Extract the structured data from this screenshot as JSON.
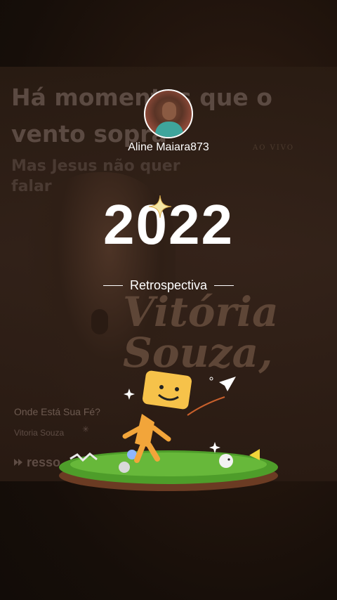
{
  "profile": {
    "username": "Aline Maiara873"
  },
  "hero": {
    "year": "2022",
    "subtitle": "Retrospectiva"
  },
  "background_card": {
    "lyrics_line1": "Há momentos que o vento sopra",
    "lyrics_line2": "Mas Jesus não quer falar",
    "artist_script": "Vitória Souza,",
    "album_tag": "AO VIVO",
    "song_title": "Onde Está Sua Fé?",
    "song_artist": "Vitoria Souza",
    "brand": "resso"
  },
  "colors": {
    "background": "#161009",
    "text": "#ffffff",
    "grass": "#4e9d2a",
    "mascot": "#f2a53a"
  },
  "icons": [
    "sparkle-icon",
    "paper-plane-icon",
    "loader-icon",
    "resso-logo-icon"
  ]
}
